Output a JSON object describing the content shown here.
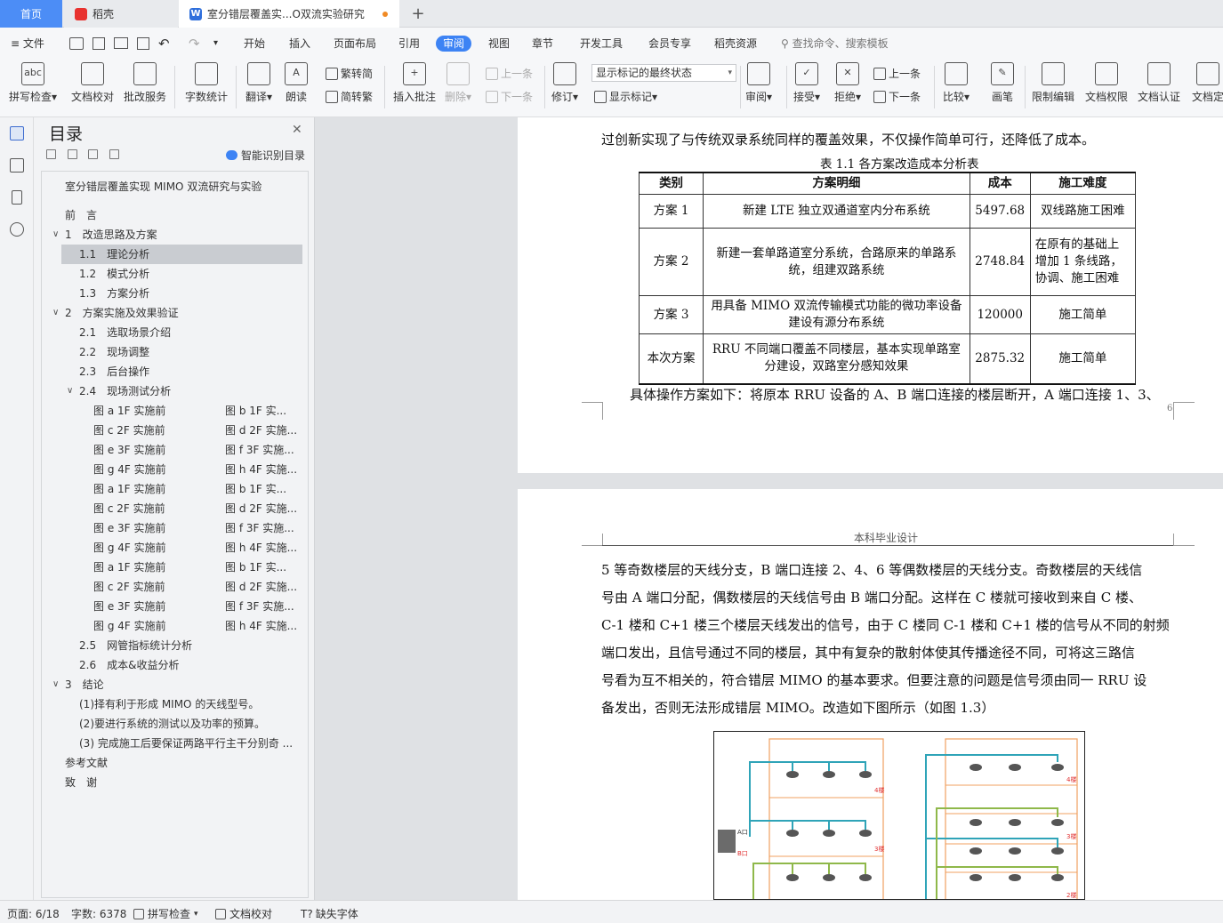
{
  "tabs": {
    "home": "首页",
    "daoke": "稻壳",
    "doc": "室分错层覆盖实...O双流实验研究"
  },
  "menu": {
    "file": "文件",
    "items": [
      "开始",
      "插入",
      "页面布局",
      "引用",
      "审阅",
      "视图",
      "章节",
      "开发工具",
      "会员专享",
      "稻壳资源"
    ],
    "active": "审阅",
    "search": "查找命令、搜索模板"
  },
  "ribbon": {
    "spell": "拼写检查",
    "doc_check": "文档校对",
    "batch": "批改服务",
    "word_count": "字数统计",
    "translate": "翻译",
    "read": "朗读",
    "trad": "繁转简",
    "simp": "简转繁",
    "insert_comment": "插入批注",
    "delete": "删除",
    "prev_c": "上一条",
    "next_c": "下一条",
    "track": "修订",
    "markup_select": "显示标记的最终状态",
    "show_markup": "显示标记",
    "review": "审阅",
    "accept": "接受",
    "reject": "拒绝",
    "prev": "上一条",
    "next": "下一条",
    "compare": "比较",
    "pen": "画笔",
    "restrict": "限制编辑",
    "perm": "文档权限",
    "auth": "文档认证",
    "docfinal": "文档定"
  },
  "nav": {
    "title": "目录",
    "smart": "智能识别目录",
    "doc_title": "室分错层覆盖实现 MIMO 双流研究与实验",
    "items": [
      {
        "t": "前　言"
      },
      {
        "t": "1　改造思路及方案"
      },
      {
        "t": "1.1　理论分析"
      },
      {
        "t": "1.2　模式分析"
      },
      {
        "t": "1.3　方案分析"
      },
      {
        "t": "2　方案实施及效果验证"
      },
      {
        "t": "2.1　选取场景介绍"
      },
      {
        "t": "2.2　现场调整"
      },
      {
        "t": "2.3　后台操作"
      },
      {
        "t": "2.4　现场测试分析"
      },
      {
        "t": "图 a 1F 实施前",
        "r": "图 b 1F 实..."
      },
      {
        "t": "图 c 2F 实施前",
        "r": "图 d 2F 实施..."
      },
      {
        "t": "图 e 3F 实施前",
        "r": "图 f 3F 实施..."
      },
      {
        "t": "图 g 4F 实施前",
        "r": "图 h 4F 实施..."
      },
      {
        "t": "图 a 1F 实施前",
        "r": "图 b 1F 实..."
      },
      {
        "t": "图 c 2F 实施前",
        "r": "图 d 2F 实施..."
      },
      {
        "t": "图 e 3F 实施前",
        "r": "图 f 3F 实施..."
      },
      {
        "t": "图 g 4F 实施前",
        "r": "图 h 4F 实施..."
      },
      {
        "t": "图 a 1F 实施前",
        "r": "图 b 1F 实..."
      },
      {
        "t": "图 c 2F 实施前",
        "r": "图 d 2F 实施..."
      },
      {
        "t": "图 e 3F 实施前",
        "r": "图 f 3F 实施..."
      },
      {
        "t": "图 g 4F 实施前",
        "r": "图 h 4F 实施..."
      },
      {
        "t": "2.5　网管指标统计分析"
      },
      {
        "t": "2.6　成本&收益分析"
      },
      {
        "t": "3　结论"
      },
      {
        "t": "(1)择有利于形成 MIMO 的天线型号。"
      },
      {
        "t": "(2)要进行系统的测试以及功率的预算。"
      },
      {
        "t": "(3)  完成施工后要保证两路平行主干分别奇 ..."
      },
      {
        "t": "参考文献"
      },
      {
        "t": "致　谢"
      }
    ]
  },
  "page1": {
    "line_top": "过创新实现了与传统双录系统同样的覆盖效果，不仅操作简单可行，还降低了成本。",
    "caption": "表 1.1  各方案改造成本分析表",
    "headers": [
      "类别",
      "方案明细",
      "成本",
      "施工难度"
    ],
    "rows": [
      [
        "方案 1",
        "新建 LTE 独立双通道室内分布系统",
        "5497.68",
        "双线路施工困难"
      ],
      [
        "方案 2",
        "新建一套单路道室分系统，合路原来的单路系统，组建双路系统",
        "2748.84",
        "在原有的基础上增加 1 条线路，协调、施工困难"
      ],
      [
        "方案 3",
        "用具备 MIMO 双流传输模式功能的微功率设备建设有源分布系统",
        "120000",
        "施工简单"
      ],
      [
        "本次方案",
        "RRU 不同端口覆盖不同楼层，基本实现单路室分建设，双路室分感知效果",
        "2875.32",
        "施工简单"
      ]
    ],
    "line_after": "具体操作方案如下：将原本 RRU 设备的 A、B 端口连接的楼层断开，A 端口连接 1、3、",
    "page_num": "6"
  },
  "page2": {
    "header": "本科毕业设计",
    "lines": [
      "5 等奇数楼层的天线分支，B 端口连接 2、4、6 等偶数楼层的天线分支。奇数楼层的天线信",
      "号由 A 端口分配，偶数楼层的天线信号由 B 端口分配。这样在 C 楼就可接收到来自 C 楼、",
      "C-1 楼和 C+1 楼三个楼层天线发出的信号，由于 C 楼同 C-1 楼和 C+1 楼的信号从不同的射频",
      "端口发出，且信号通过不同的楼层，其中有复杂的散射体使其传播途径不同，可将这三路信",
      "号看为互不相关的，符合错层 MIMO 的基本要求。但要注意的问题是信号须由同一 RRU 设",
      "备发出，否则无法形成错层 MIMO。改造如下图所示（如图 1.3）"
    ],
    "fig": {
      "floor4": "4楼",
      "floor3": "3楼",
      "floor2": "2楼",
      "portA": "A口",
      "portB": "B口"
    }
  },
  "status": {
    "page": "页面: 6/18",
    "words": "字数: 6378",
    "spell": "拼写检查",
    "doccheck": "文档校对",
    "missing_font": "缺失字体"
  },
  "colors": {
    "accent": "#3d83f4",
    "orange": "#f0a060",
    "teal": "#2fa4b8",
    "green": "#8fb84a",
    "red": "#e03030"
  }
}
